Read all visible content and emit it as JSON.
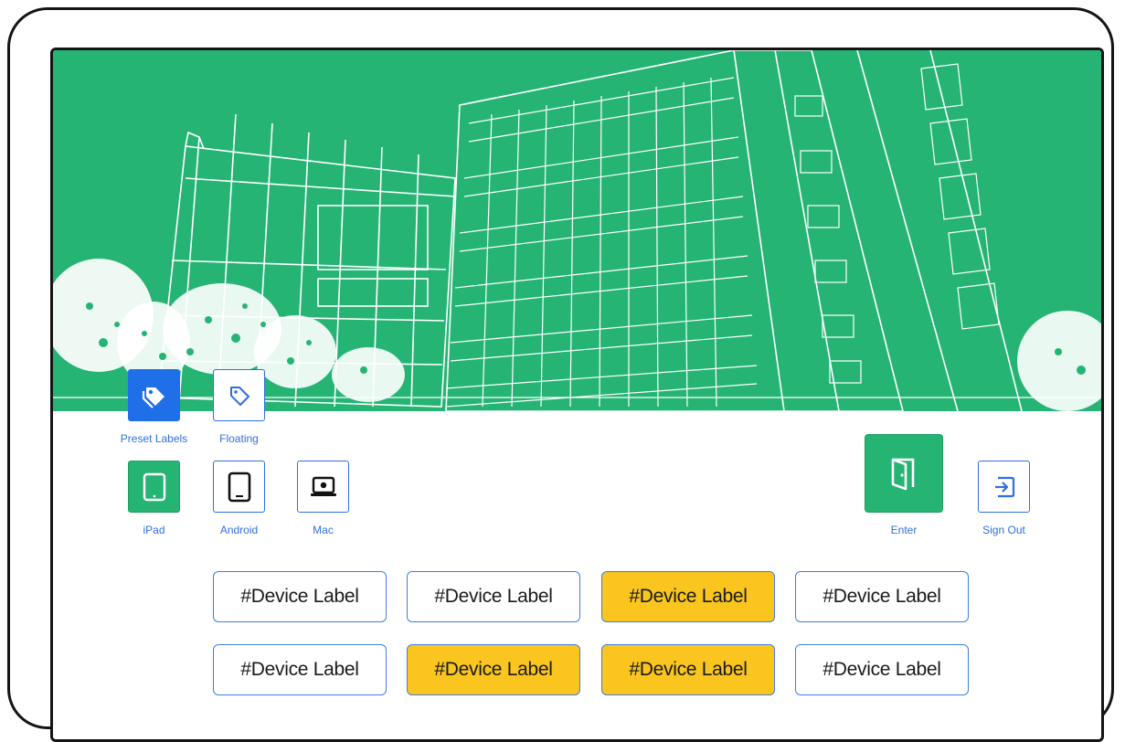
{
  "label_mode": [
    {
      "label": "Preset Labels",
      "icon": "tags-icon",
      "selected": true
    },
    {
      "label": "Floating",
      "icon": "tag-icon",
      "selected": false
    }
  ],
  "platforms": [
    {
      "label": "iPad",
      "icon": "tablet-icon",
      "selected": true
    },
    {
      "label": "Android",
      "icon": "android-tablet-icon",
      "selected": false
    },
    {
      "label": "Mac",
      "icon": "laptop-icon",
      "selected": false
    }
  ],
  "actions": {
    "enter_label": "Enter",
    "sign_out_label": "Sign Out"
  },
  "device_labels": [
    {
      "text": "#Device Label",
      "selected": false
    },
    {
      "text": "#Device Label",
      "selected": false
    },
    {
      "text": "#Device Label",
      "selected": true
    },
    {
      "text": "#Device Label",
      "selected": false
    },
    {
      "text": "#Device Label",
      "selected": false
    },
    {
      "text": "#Device Label",
      "selected": true
    },
    {
      "text": "#Device Label",
      "selected": true
    },
    {
      "text": "#Device Label",
      "selected": false
    }
  ],
  "colors": {
    "hero_green": "#25b474",
    "accent_blue": "#1f6fe8",
    "selected_label": "#f9c51e"
  }
}
